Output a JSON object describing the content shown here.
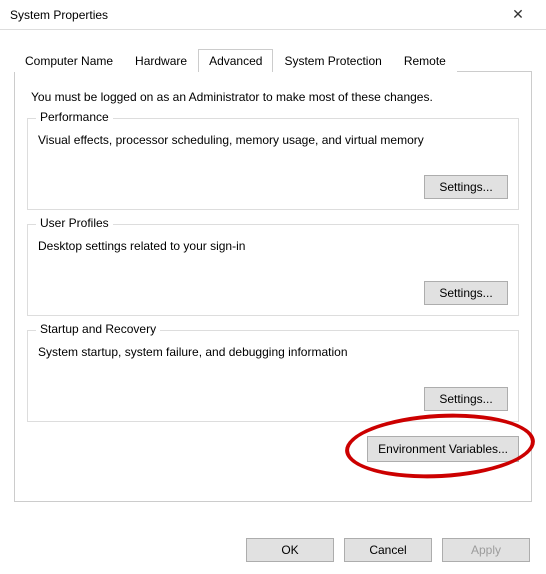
{
  "window": {
    "title": "System Properties",
    "close_glyph": "✕"
  },
  "tabs": {
    "computer_name": "Computer Name",
    "hardware": "Hardware",
    "advanced": "Advanced",
    "system_protection": "System Protection",
    "remote": "Remote"
  },
  "advanced": {
    "intro": "You must be logged on as an Administrator to make most of these changes.",
    "performance": {
      "legend": "Performance",
      "desc": "Visual effects, processor scheduling, memory usage, and virtual memory",
      "settings_btn": "Settings..."
    },
    "user_profiles": {
      "legend": "User Profiles",
      "desc": "Desktop settings related to your sign-in",
      "settings_btn": "Settings..."
    },
    "startup": {
      "legend": "Startup and Recovery",
      "desc": "System startup, system failure, and debugging information",
      "settings_btn": "Settings..."
    },
    "env_vars_btn": "Environment Variables..."
  },
  "dialog": {
    "ok": "OK",
    "cancel": "Cancel",
    "apply": "Apply"
  }
}
